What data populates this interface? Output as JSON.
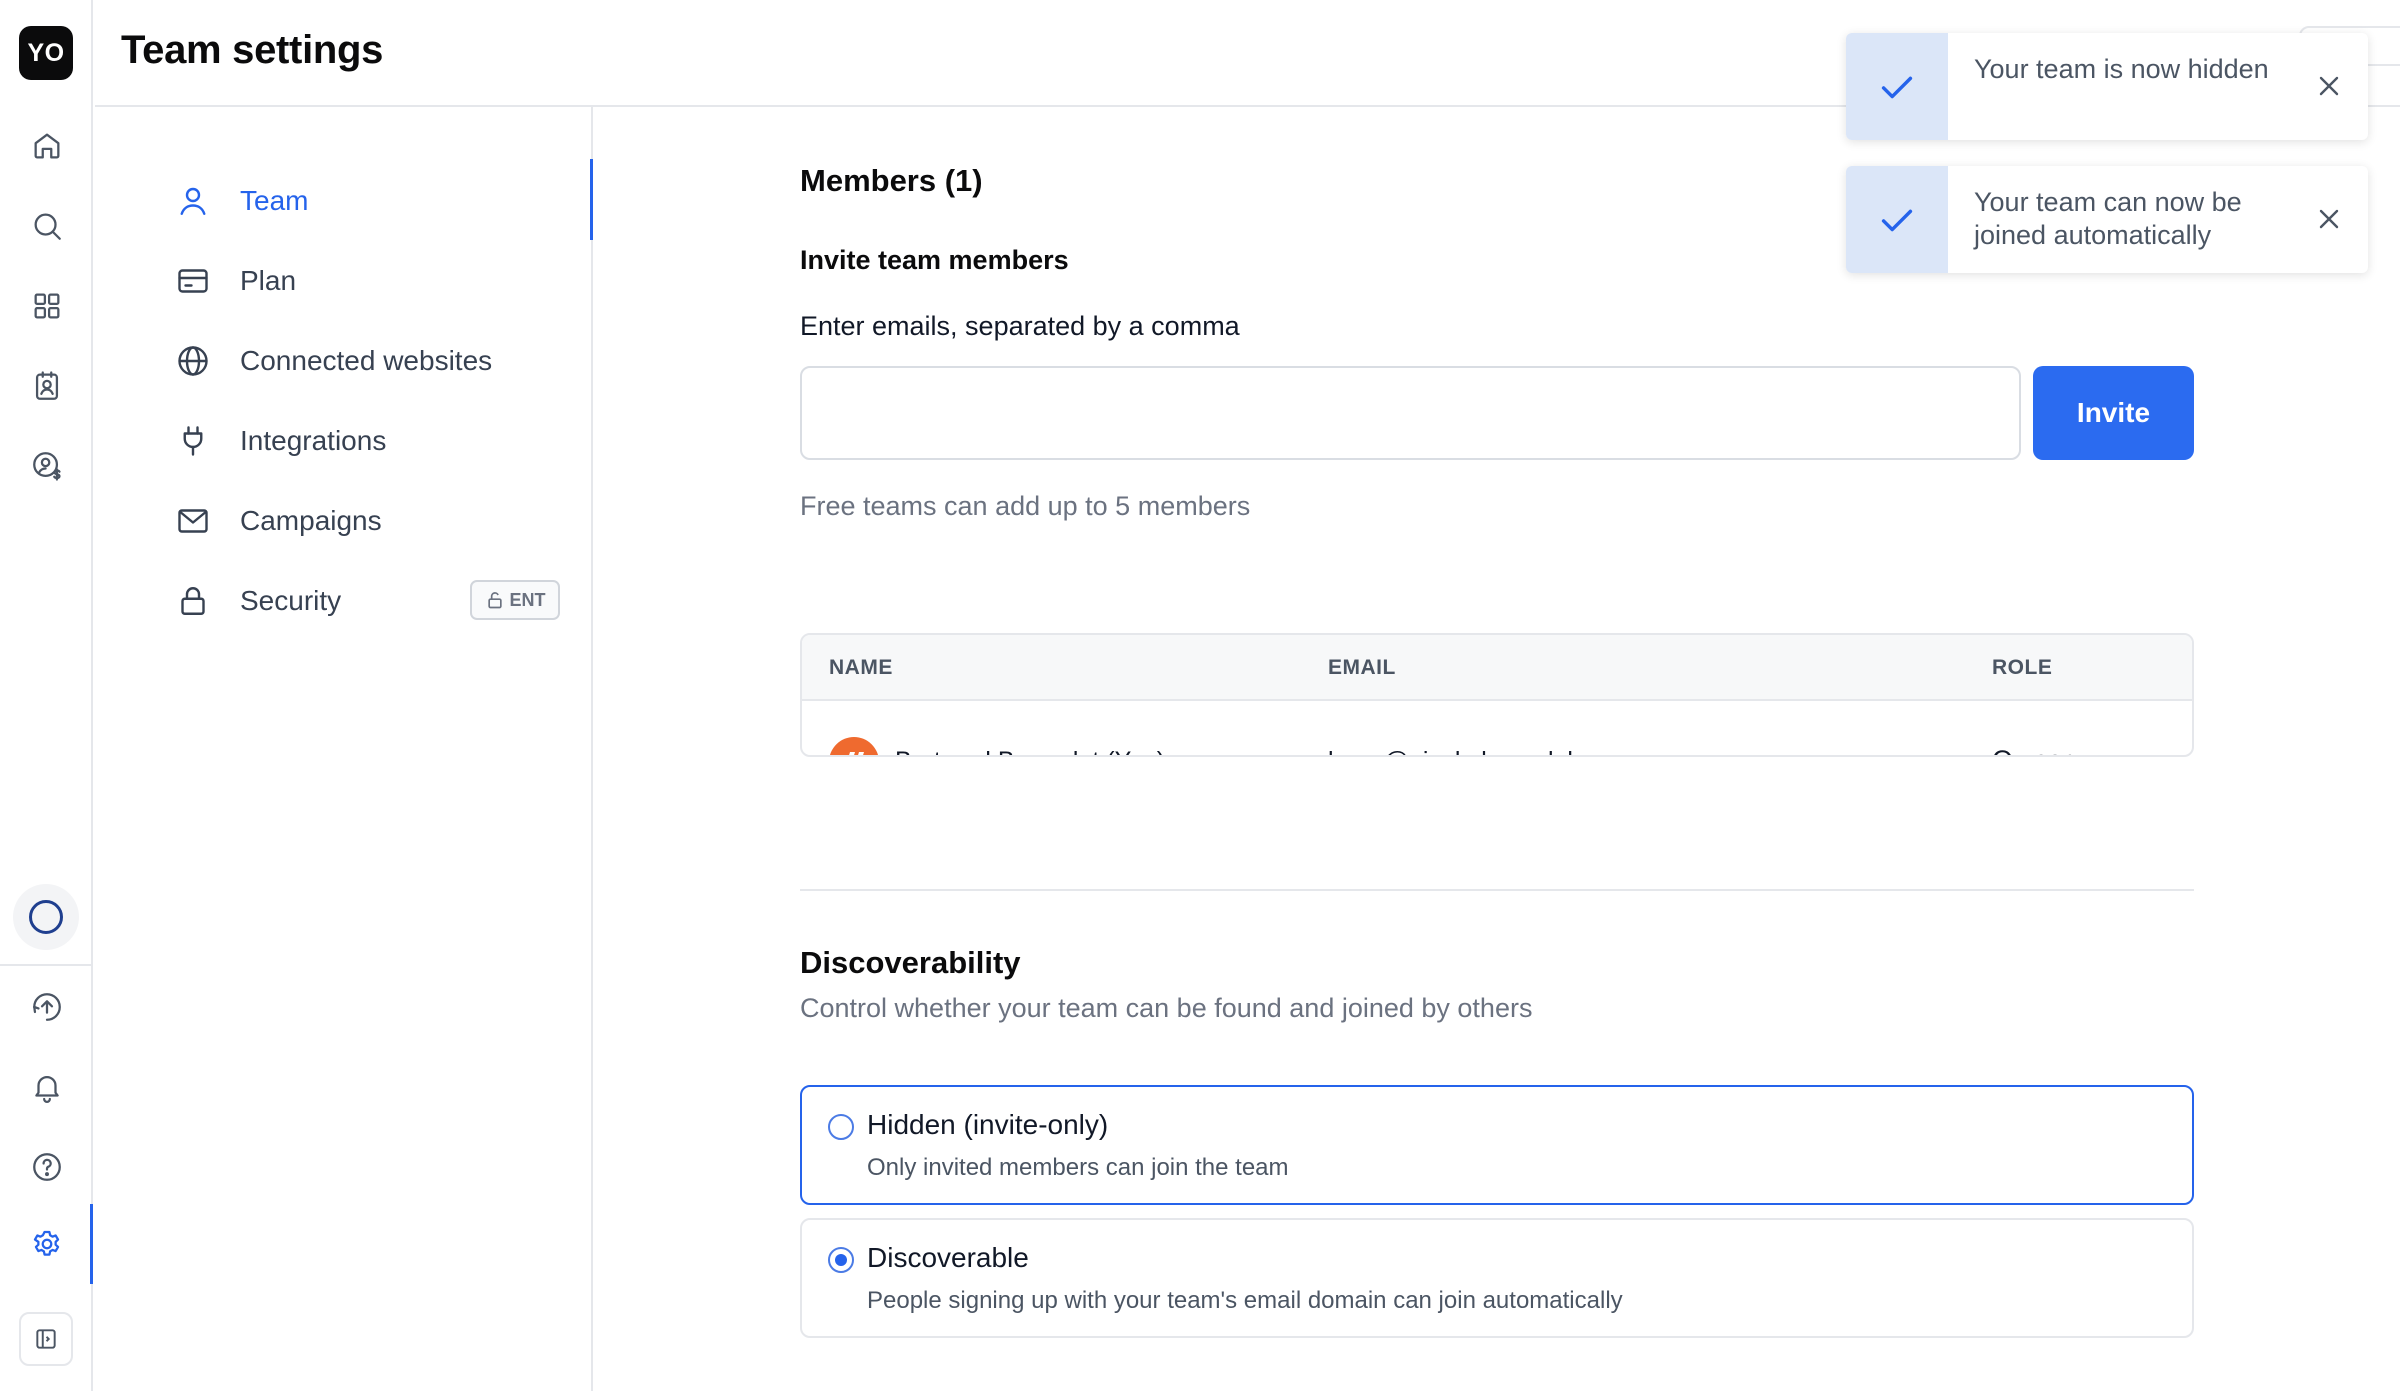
{
  "app": {
    "logo_text": "YO"
  },
  "header": {
    "title": "Team settings"
  },
  "rail": {
    "top_icons": [
      "home-icon",
      "search-icon",
      "apps-grid-icon",
      "contacts-icon",
      "billing-user-icon"
    ],
    "bottom_icons": [
      "upload-icon",
      "bell-icon",
      "help-icon",
      "settings-icon"
    ],
    "active": "settings-icon"
  },
  "settings_nav": {
    "items": [
      {
        "label": "Team",
        "icon": "user-icon",
        "active": true
      },
      {
        "label": "Plan",
        "icon": "credit-card-icon",
        "active": false
      },
      {
        "label": "Connected websites",
        "icon": "globe-icon",
        "active": false
      },
      {
        "label": "Integrations",
        "icon": "plug-icon",
        "active": false
      },
      {
        "label": "Campaigns",
        "icon": "mail-icon",
        "active": false
      },
      {
        "label": "Security",
        "icon": "lock-icon",
        "active": false,
        "badge": "ENT"
      }
    ]
  },
  "members": {
    "title": "Members (1)",
    "invite_title": "Invite team members",
    "invite_help": "Enter emails, separated by a comma",
    "input_value": "",
    "invite_button": "Invite",
    "note": "Free teams can add up to 5 members",
    "columns": [
      "NAME",
      "EMAIL",
      "ROLE"
    ],
    "rows": [
      {
        "name": "Bertrand Bruandet (You)",
        "email": "laura@nicelydone.club",
        "role": "Owner"
      }
    ]
  },
  "discoverability": {
    "title": "Discoverability",
    "subtitle": "Control whether your team can be found and joined by others",
    "options": [
      {
        "label": "Hidden (invite-only)",
        "description": "Only invited members can join the team",
        "selected": false
      },
      {
        "label": "Discoverable",
        "description": "People signing up with your team's email domain can join automatically",
        "selected": true
      }
    ]
  },
  "toasts": [
    {
      "message": "Your team is now hidden"
    },
    {
      "message": "Your team can now be joined automatically"
    }
  ],
  "colors": {
    "accent": "#2563eb",
    "toast_side": "#dbe6f8",
    "avatar": "#ef6a2f"
  }
}
